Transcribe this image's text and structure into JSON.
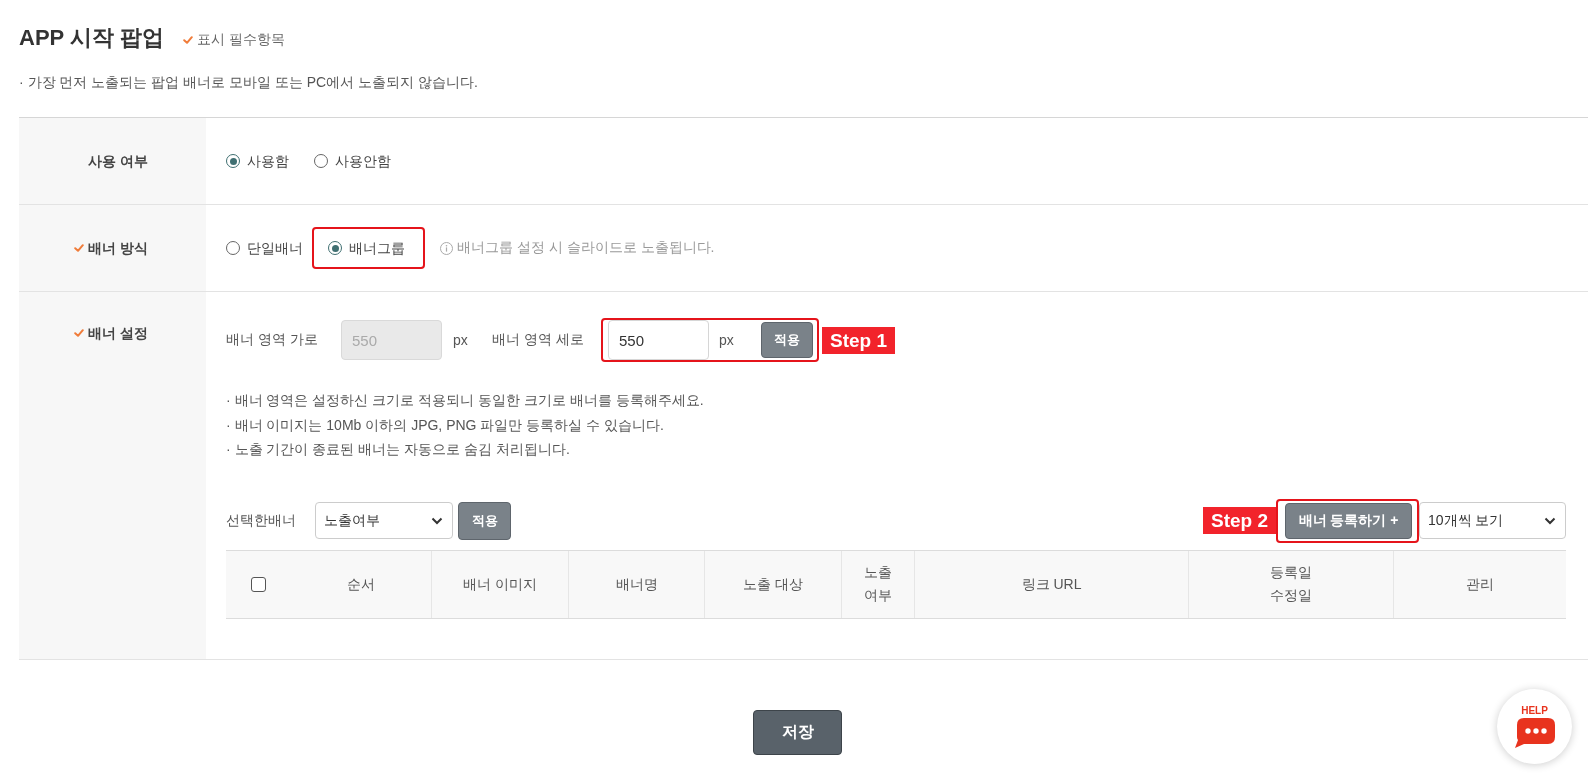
{
  "header": {
    "title": "APP 시작 팝업",
    "required_note": "표시 필수항목",
    "description": "· 가장 먼저 노출되는 팝업 배너로 모바일 또는 PC에서 노출되지 않습니다."
  },
  "form": [
    {
      "kind": "radio",
      "label": "사용 여부",
      "required": false,
      "options": [
        {
          "label": "사용함",
          "selected": true,
          "highlighted": false
        },
        {
          "label": "사용안함",
          "selected": false,
          "highlighted": false
        }
      ]
    },
    {
      "kind": "radio",
      "label": "배너 방식",
      "required": true,
      "options": [
        {
          "label": "단일배너",
          "selected": false,
          "highlighted": false
        },
        {
          "label": "배너그룹",
          "selected": true,
          "highlighted": true
        }
      ],
      "hint": "배너그룹 설정 시 슬라이드로 노출됩니다."
    },
    {
      "kind": "banner_settings",
      "label": "배너 설정",
      "required": true,
      "width_field": {
        "label": "배너 영역 가로",
        "value": "550",
        "unit": "px",
        "disabled": true
      },
      "height_field": {
        "label": "배너 영역 세로",
        "value": "550",
        "unit": "px",
        "disabled": false,
        "button": "적용",
        "highlighted": true,
        "step": "Step 1"
      },
      "notes": [
        "· 배너 영역은 설정하신 크기로 적용되니 동일한 크기로 배너를 등록해주세요.",
        "· 배너 이미지는 10Mb 이하의 JPG, PNG 파일만 등록하실 수 있습니다.",
        "· 노출 기간이 종료된 배너는 자동으로 숨김 처리됩니다."
      ],
      "bulk_action": {
        "label": "선택한배너",
        "select": "노출여부",
        "button": "적용"
      },
      "add_button": {
        "label": "배너 등록하기 +",
        "highlighted": true,
        "step": "Step 2"
      },
      "page_size": "10개씩 보기",
      "table": {
        "select_all_checked": false,
        "columns": [
          "순서",
          "배너 이미지",
          "배너명",
          "노출 대상",
          "노출\n여부",
          "링크 URL",
          "등록일\n수정일",
          "관리"
        ]
      }
    }
  ],
  "save_button": "저장",
  "help_button": "HELP"
}
